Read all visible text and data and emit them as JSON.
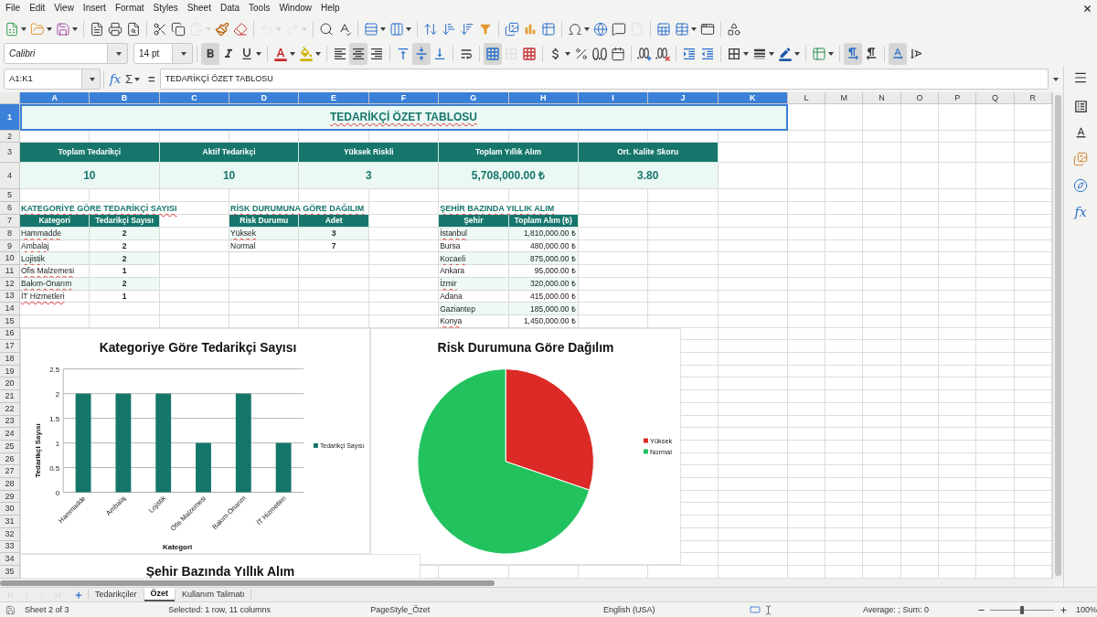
{
  "menu_bar": {
    "items": [
      "File",
      "Edit",
      "View",
      "Insert",
      "Format",
      "Styles",
      "Sheet",
      "Data",
      "Tools",
      "Window",
      "Help"
    ]
  },
  "standard_toolbar": [
    {
      "disabled": false
    },
    {
      "disabled": false
    },
    {
      "disabled": false
    },
    {
      "disabled": false
    },
    {
      "disabled": false
    },
    {
      "disabled": false
    },
    {
      "disabled": false
    },
    {
      "disabled": false
    },
    {
      "disabled": true
    },
    {
      "disabled": false
    },
    {
      "disabled": false
    },
    {
      "disabled": true
    },
    {
      "disabled": true
    },
    {
      "disabled": false
    },
    {
      "disabled": false
    },
    {
      "disabled": false
    },
    {
      "disabled": false
    },
    {
      "disabled": false
    },
    {
      "disabled": false
    },
    {
      "disabled": false
    },
    {
      "disabled": false
    },
    {
      "disabled": false
    },
    {
      "disabled": false
    },
    {
      "disabled": false
    },
    {
      "disabled": false
    },
    {
      "disabled": false
    },
    {
      "disabled": false
    },
    {
      "disabled": true
    },
    {
      "disabled": false
    },
    {
      "disabled": false
    },
    {
      "disabled": false
    },
    {
      "disabled": false
    }
  ],
  "formatting_toolbar": {
    "font_name": "Calibri",
    "font_size": "14 pt",
    "buttons": [
      {
        "active": true,
        "disabled": false
      },
      {
        "active": false,
        "disabled": false
      },
      {
        "active": false,
        "disabled": false
      },
      {
        "active": false,
        "disabled": false
      },
      {
        "active": false,
        "disabled": false
      },
      {
        "active": false,
        "disabled": false
      },
      {
        "active": true,
        "disabled": false
      },
      {
        "active": false,
        "disabled": false
      },
      {
        "active": false,
        "disabled": false
      },
      {
        "active": true,
        "disabled": false
      },
      {
        "active": false,
        "disabled": false
      },
      {
        "active": false,
        "disabled": false
      },
      {
        "active": true,
        "disabled": false
      },
      {
        "active": false,
        "disabled": true
      },
      {
        "active": false,
        "disabled": false
      },
      {
        "active": false,
        "disabled": false
      },
      {
        "active": false,
        "disabled": false
      },
      {
        "active": false,
        "disabled": false
      },
      {
        "active": false,
        "disabled": false
      },
      {
        "active": false,
        "disabled": false
      },
      {
        "active": false,
        "disabled": false
      },
      {
        "active": false,
        "disabled": false
      },
      {
        "active": false,
        "disabled": false
      },
      {
        "active": false,
        "disabled": false
      },
      {
        "active": false,
        "disabled": false
      },
      {
        "active": false,
        "disabled": false
      },
      {
        "active": false,
        "disabled": false
      },
      {
        "active": true,
        "disabled": false
      },
      {
        "active": false,
        "disabled": false
      },
      {
        "active": true,
        "disabled": false
      },
      {
        "active": false,
        "disabled": false
      }
    ]
  },
  "formula_bar": {
    "name_box": "A1:K1",
    "function_wizard": "fx",
    "sum": "Σ",
    "formula": "=",
    "content": "TEDARİKÇİ ÖZET TABLOSU"
  },
  "sidebar": {
    "functions_label": "fx"
  },
  "sheet": {
    "columns": [
      {
        "label": "A",
        "selected": true
      },
      {
        "label": "B",
        "selected": true
      },
      {
        "label": "C",
        "selected": true
      },
      {
        "label": "D",
        "selected": true
      },
      {
        "label": "E",
        "selected": true
      },
      {
        "label": "F",
        "selected": true
      },
      {
        "label": "G",
        "selected": true
      },
      {
        "label": "H",
        "selected": true
      },
      {
        "label": "I",
        "selected": true
      },
      {
        "label": "J",
        "selected": true
      },
      {
        "label": "K",
        "selected": true
      },
      {
        "label": "L",
        "selected": false
      },
      {
        "label": "M",
        "selected": false
      },
      {
        "label": "N",
        "selected": false
      },
      {
        "label": "O",
        "selected": false
      },
      {
        "label": "P",
        "selected": false
      },
      {
        "label": "Q",
        "selected": false
      },
      {
        "label": "R",
        "selected": false
      }
    ],
    "rows": [
      {
        "label": "1",
        "selected": true
      },
      {
        "label": "2",
        "selected": false
      },
      {
        "label": "3",
        "selected": false
      },
      {
        "label": "4",
        "selected": false
      },
      {
        "label": "5",
        "selected": false
      },
      {
        "label": "6",
        "selected": false
      },
      {
        "label": "7",
        "selected": false
      },
      {
        "label": "8",
        "selected": false
      },
      {
        "label": "9",
        "selected": false
      },
      {
        "label": "10",
        "selected": false
      },
      {
        "label": "11",
        "selected": false
      },
      {
        "label": "12",
        "selected": false
      },
      {
        "label": "13",
        "selected": false
      },
      {
        "label": "14",
        "selected": false
      },
      {
        "label": "15",
        "selected": false
      },
      {
        "label": "16",
        "selected": false
      },
      {
        "label": "17",
        "selected": false
      },
      {
        "label": "18",
        "selected": false
      },
      {
        "label": "19",
        "selected": false
      },
      {
        "label": "20",
        "selected": false
      },
      {
        "label": "21",
        "selected": false
      },
      {
        "label": "22",
        "selected": false
      },
      {
        "label": "23",
        "selected": false
      },
      {
        "label": "24",
        "selected": false
      },
      {
        "label": "25",
        "selected": false
      },
      {
        "label": "26",
        "selected": false
      },
      {
        "label": "27",
        "selected": false
      },
      {
        "label": "28",
        "selected": false
      },
      {
        "label": "29",
        "selected": false
      },
      {
        "label": "30",
        "selected": false
      },
      {
        "label": "31",
        "selected": false
      },
      {
        "label": "32",
        "selected": false
      },
      {
        "label": "33",
        "selected": false
      },
      {
        "label": "34",
        "selected": false
      },
      {
        "label": "35",
        "selected": false
      }
    ],
    "title": {
      "text": "TEDARİKÇİ ÖZET TABLOSU",
      "selected": true,
      "spelling_flagged": true
    },
    "kpis": [
      {
        "label": "Toplam Tedarikçi",
        "value": "10"
      },
      {
        "label": "Aktif Tedarikçi",
        "value": "10"
      },
      {
        "label": "Yüksek Riskli",
        "value": "3"
      },
      {
        "label": "Toplam Yıllık Alım",
        "value": "5,708,000.00 ₺"
      },
      {
        "label": "Ort. Kalite Skoru",
        "value": "3.80"
      }
    ],
    "sections": [
      {
        "kind": "count",
        "title": "KATEGORİYE GÖRE TEDARİKÇİ SAYISI",
        "spelling_flagged": true,
        "headers": [
          "Kategori",
          "Tedarikçi Sayısı"
        ],
        "rows": [
          {
            "label": "Hammadde",
            "value": "2",
            "spelling_flagged": true
          },
          {
            "label": "Ambalaj",
            "value": "2",
            "spelling_flagged": true
          },
          {
            "label": "Lojistik",
            "value": "2",
            "spelling_flagged": true
          },
          {
            "label": "Ofis Malzemesi",
            "value": "1",
            "spelling_flagged": true
          },
          {
            "label": "Bakım-Onarım",
            "value": "2",
            "spelling_flagged": true
          },
          {
            "label": "İT Hizmetleri",
            "value": "1",
            "spelling_flagged": true
          }
        ]
      },
      {
        "kind": "count",
        "title": "RİSK DURUMUNA GÖRE DAĞILIM",
        "spelling_flagged": true,
        "headers": [
          "Risk Durumu",
          "Adet"
        ],
        "rows": [
          {
            "label": "Yüksek",
            "value": "3",
            "spelling_flagged": true
          },
          {
            "label": "Normal",
            "value": "7",
            "spelling_flagged": false
          }
        ]
      },
      {
        "kind": "amount",
        "title": "ŞEHİR BAZINDA YILLIK ALIM",
        "spelling_flagged": true,
        "headers": [
          "Şehir",
          "Toplam Alım (₺)"
        ],
        "rows": [
          {
            "label": "İstanbul",
            "value": "1,810,000.00 ₺",
            "spelling_flagged": true
          },
          {
            "label": "Bursa",
            "value": "480,000.00 ₺",
            "spelling_flagged": false
          },
          {
            "label": "Kocaeli",
            "value": "875,000.00 ₺",
            "spelling_flagged": true
          },
          {
            "label": "Ankara",
            "value": "95,000.00 ₺",
            "spelling_flagged": false
          },
          {
            "label": "İzmir",
            "value": "320,000.00 ₺",
            "spelling_flagged": true
          },
          {
            "label": "Adana",
            "value": "415,000.00 ₺",
            "spelling_flagged": false
          },
          {
            "label": "Gaziantep",
            "value": "185,000.00 ₺",
            "spelling_flagged": false
          },
          {
            "label": "Konya",
            "value": "1,450,000.00 ₺",
            "spelling_flagged": true
          }
        ]
      }
    ],
    "charts": [
      {
        "chart_data": {
          "type": "bar",
          "title": "Kategoriye Göre Tedarikçi Sayısı",
          "xlabel": "Kategori",
          "ylabel": "Tedarikçi Sayısı",
          "categories": [
            "Hammadde",
            "Ambalaj",
            "Lojistik",
            "Ofis Malzemesi",
            "Bakım-Onarım",
            "İT Hizmetleri"
          ],
          "series": [
            {
              "name": "Tedarikçi Sayısı",
              "color": "#15766a",
              "values": [
                2,
                2,
                2,
                1,
                2,
                1
              ]
            }
          ],
          "ylim": [
            0,
            2.5
          ],
          "yticks": [
            {
              "value": 0,
              "label": "0"
            },
            {
              "value": 0.5,
              "label": "0.5"
            },
            {
              "value": 1,
              "label": "1"
            },
            {
              "value": 1.5,
              "label": "1.5"
            },
            {
              "value": 2,
              "label": "2"
            },
            {
              "value": 2.5,
              "label": "2.5"
            }
          ],
          "grid": true,
          "legend": "right"
        }
      },
      {
        "chart_data": {
          "type": "pie",
          "title": "Risk Durumuna Göre Dağılım",
          "categories": [
            "Yüksek",
            "Normal"
          ],
          "colors": [
            "#dc2a26",
            "#22c35e"
          ],
          "series": [
            {
              "values": [
                30,
                70
              ]
            }
          ],
          "legend": "right"
        }
      },
      {
        "title": "Şehir Bazında Yıllık Alım"
      }
    ]
  },
  "sheet_tabs": {
    "navigation": [
      {
        "disabled": true
      },
      {
        "disabled": true
      },
      {
        "disabled": true
      },
      {
        "disabled": true
      }
    ],
    "tabs": [
      {
        "label": "Tedarikçiler",
        "selected": false
      },
      {
        "label": "Özet",
        "selected": true
      },
      {
        "label": "Kullanım Talimatı",
        "selected": false
      }
    ]
  },
  "status_bar": {
    "sheet_position": "Sheet 2 of 3",
    "selection": "Selected: 1 row, 11 columns",
    "page_style": "PageStyle_Özet",
    "language": "English (USA)",
    "summary": "Average: ; Sum: 0",
    "zoom": {
      "level": 0.5,
      "reading": "100%"
    }
  }
}
